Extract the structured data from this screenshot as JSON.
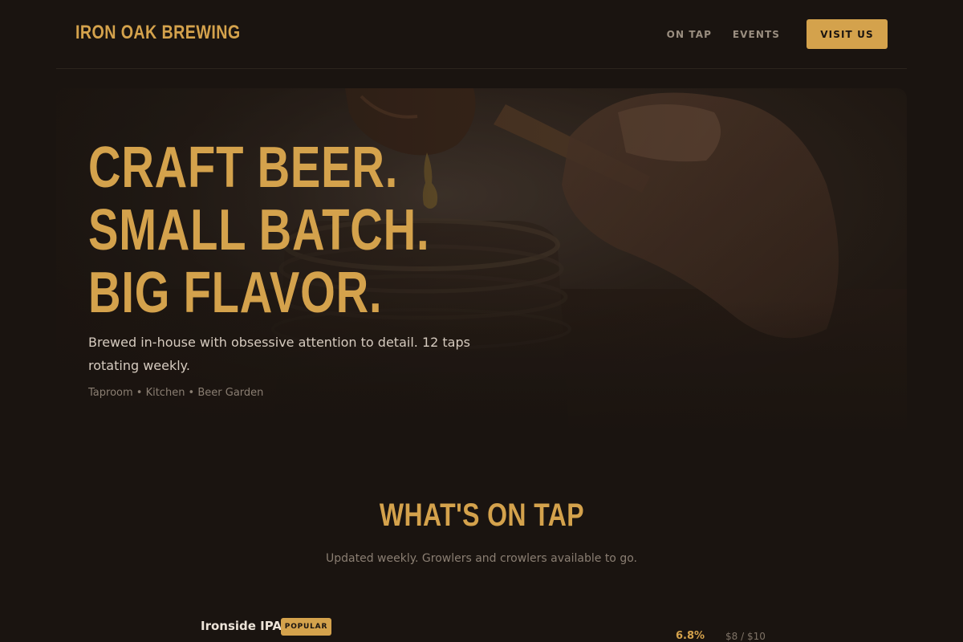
{
  "brand": {
    "name": "IRON OAK BREWING"
  },
  "nav": {
    "items": [
      {
        "label": "ON TAP"
      },
      {
        "label": "EVENTS"
      }
    ],
    "cta_label": "VISIT US"
  },
  "hero": {
    "headline": [
      "CRAFT BEER.",
      "SMALL BATCH.",
      "BIG FLAVOR."
    ],
    "description": "Brewed in-house with obsessive attention to detail. 12 taps rotating weekly.",
    "meta": "Taproom • Kitchen • Beer Garden",
    "image": "honey-dripper-jar-photo"
  },
  "on_tap": {
    "title": "WHAT'S ON TAP",
    "subtitle": "Updated weekly. Growlers and crowlers available to go.",
    "beers": [
      {
        "name": "Ironside IPA",
        "badge": "POPULAR",
        "abv": "6.8%",
        "price": "$8 / $10"
      }
    ]
  },
  "colors": {
    "background": "#1a1410",
    "accent": "#d4a24c",
    "text": "#d8cfc4",
    "muted": "#8a7e72"
  }
}
